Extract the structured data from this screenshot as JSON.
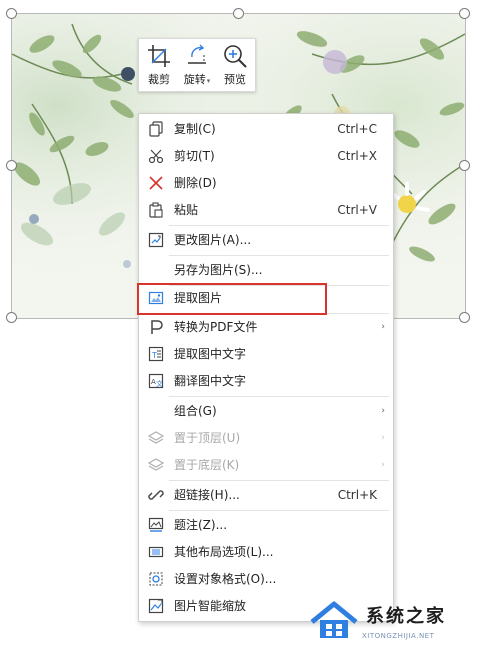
{
  "toolbar": {
    "items": [
      {
        "label": "裁剪",
        "icon": "crop-icon"
      },
      {
        "label": "旋转",
        "icon": "rotate-icon",
        "arrow": "▾"
      },
      {
        "label": "预览",
        "icon": "zoom-icon"
      }
    ]
  },
  "menu": {
    "items": [
      {
        "label": "复制(C)",
        "shortcut": "Ctrl+C",
        "icon": "copy-icon"
      },
      {
        "label": "剪切(T)",
        "shortcut": "Ctrl+X",
        "icon": "scissors-icon"
      },
      {
        "label": "删除(D)",
        "shortcut": "",
        "icon": "delete-x-icon"
      },
      {
        "label": "粘贴",
        "shortcut": "Ctrl+V",
        "icon": "paste-icon"
      },
      {
        "label": "更改图片(A)...",
        "shortcut": "",
        "icon": "change-image-icon"
      },
      {
        "label": "另存为图片(S)...",
        "shortcut": "",
        "icon": ""
      },
      {
        "label": "提取图片",
        "shortcut": "",
        "icon": "extract-image-icon"
      },
      {
        "label": "转换为PDF文件",
        "shortcut": "",
        "icon": "pdf-icon",
        "arrow": "›"
      },
      {
        "label": "提取图中文字",
        "shortcut": "",
        "icon": "ocr-icon"
      },
      {
        "label": "翻译图中文字",
        "shortcut": "",
        "icon": "translate-icon"
      },
      {
        "label": "组合(G)",
        "shortcut": "",
        "icon": "",
        "arrow": "›"
      },
      {
        "label": "置于顶层(U)",
        "shortcut": "",
        "icon": "layers-icon",
        "arrow": "›",
        "disabled": true
      },
      {
        "label": "置于底层(K)",
        "shortcut": "",
        "icon": "layers-icon",
        "arrow": "›",
        "disabled": true
      },
      {
        "label": "超链接(H)...",
        "shortcut": "Ctrl+K",
        "icon": "link-icon"
      },
      {
        "label": "题注(Z)...",
        "shortcut": "",
        "icon": "caption-icon"
      },
      {
        "label": "其他布局选项(L)...",
        "shortcut": "",
        "icon": "layout-icon"
      },
      {
        "label": "设置对象格式(O)...",
        "shortcut": "",
        "icon": "format-icon"
      },
      {
        "label": "图片智能缩放",
        "shortcut": "",
        "icon": "smart-scale-icon"
      }
    ]
  },
  "watermark": {
    "brand": "系统之家",
    "url": "XITONGZHIJIA.NET"
  },
  "colors": {
    "highlight": "#d9342b",
    "watermark_blue": "#2f7fe0"
  }
}
